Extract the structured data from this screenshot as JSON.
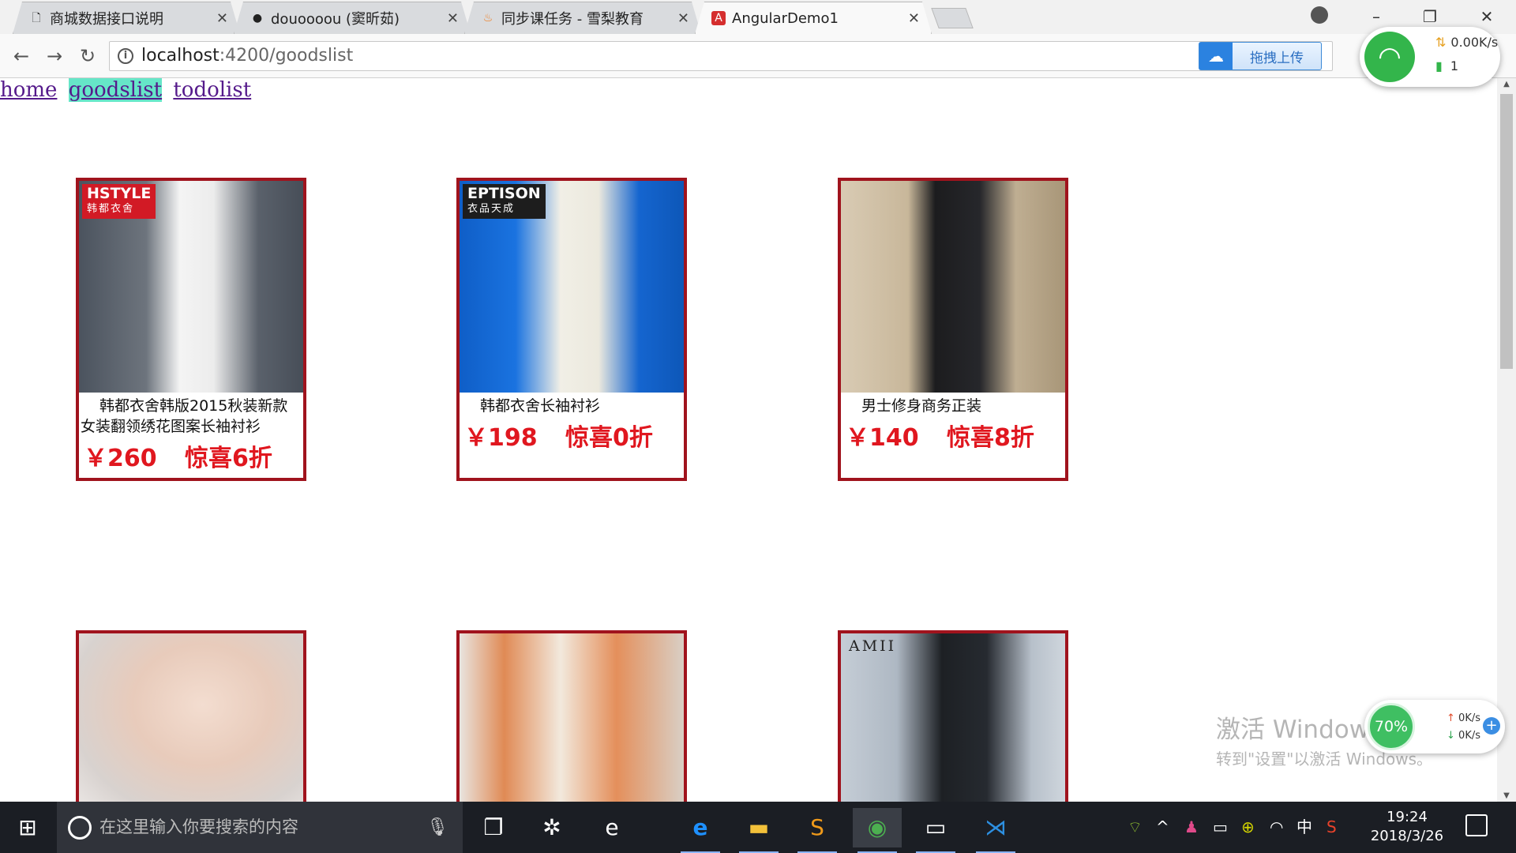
{
  "browser": {
    "tabs": [
      {
        "title": "商城数据接口说明",
        "icon": "document-icon"
      },
      {
        "title": "douoooou (窦昕茹)",
        "icon": "github-icon"
      },
      {
        "title": "同步课任务 - 雪梨教育",
        "icon": "fire-icon"
      },
      {
        "title": "AngularDemo1",
        "icon": "angular-icon",
        "active": true
      }
    ],
    "url_host": "localhost",
    "url_path": ":4200/goodslist",
    "upload_label": "拖拽上传"
  },
  "net_widget": {
    "speed": "0.00K/s",
    "connections": "1"
  },
  "nav": {
    "links": [
      "home",
      "goodslist",
      "todolist"
    ],
    "active": "goodslist"
  },
  "products": [
    {
      "brand": "HSTYLE",
      "brand_sub": "韩都衣舍",
      "name": "韩都衣舍韩版2015秋装新款女装翻领绣花图案长袖衬衫",
      "price": "￥260",
      "promo": "惊喜6折",
      "image": "woman-white-blouse-photo"
    },
    {
      "brand": "EPTISON",
      "brand_sub": "衣品天成",
      "name": "韩都衣舍长袖衬衫",
      "price": "￥198",
      "promo": "惊喜0折",
      "image": "woman-shirt-blue-background-photo"
    },
    {
      "brand": "",
      "brand_sub": "",
      "name": "男士修身商务正装",
      "price": "￥140",
      "promo": "惊喜8折",
      "image": "man-black-suit-photo"
    },
    {
      "brand": "",
      "brand_sub": "",
      "name": "",
      "price": "",
      "promo": "",
      "image": "woman-lace-blouse-photo"
    },
    {
      "brand": "",
      "brand_sub": "",
      "name": "",
      "price": "",
      "promo": "",
      "image": "women-orange-jackets-photo"
    },
    {
      "brand": "AMII",
      "brand_sub": "",
      "name": "",
      "price": "",
      "promo": "",
      "image": "woman-black-jacket-photo"
    }
  ],
  "watermark": {
    "line1": "激活 Window",
    "line2": "转到\"设置\"以激活 Windows。"
  },
  "speed_widget": {
    "percent": "70%",
    "up": "0K/s",
    "down": "0K/s"
  },
  "taskbar": {
    "search_placeholder": "在这里输入你要搜索的内容",
    "ime": "中",
    "time": "19:24",
    "date": "2018/3/26"
  },
  "colors": {
    "card_border": "#a0131d",
    "price_red": "#e0171f",
    "active_link_bg": "#66e6c8"
  }
}
